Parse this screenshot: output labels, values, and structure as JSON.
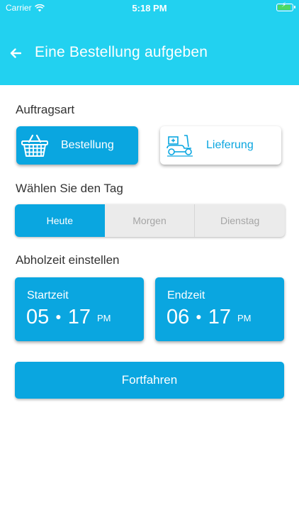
{
  "status_bar": {
    "carrier": "Carrier",
    "time": "5:18 PM",
    "battery_color": "#4cd964"
  },
  "header": {
    "title": "Eine Bestellung aufgeben",
    "background": "#22d1f0",
    "back_icon": "arrow-left-icon"
  },
  "order_type": {
    "label": "Auftragsart",
    "options": [
      {
        "label": "Bestellung",
        "icon": "shopping-basket-icon",
        "selected": true
      },
      {
        "label": "Lieferung",
        "icon": "delivery-scooter-icon",
        "selected": false
      }
    ]
  },
  "day": {
    "label": "Wählen Sie den Tag",
    "options": [
      {
        "label": "Heute",
        "selected": true
      },
      {
        "label": "Morgen",
        "selected": false
      },
      {
        "label": "Dienstag",
        "selected": false
      }
    ]
  },
  "pickup": {
    "label": "Abholzeit einstellen",
    "start": {
      "caption": "Startzeit",
      "hour": "05",
      "minute": "17",
      "ampm": "PM"
    },
    "end": {
      "caption": "Endzeit",
      "hour": "06",
      "minute": "17",
      "ampm": "PM"
    }
  },
  "continue_button": {
    "label": "Fortfahren"
  },
  "colors": {
    "primary": "#0aa6e0",
    "header": "#22d1f0",
    "inactive_segment": "#ebebeb",
    "inactive_text": "#a5a5a5"
  }
}
